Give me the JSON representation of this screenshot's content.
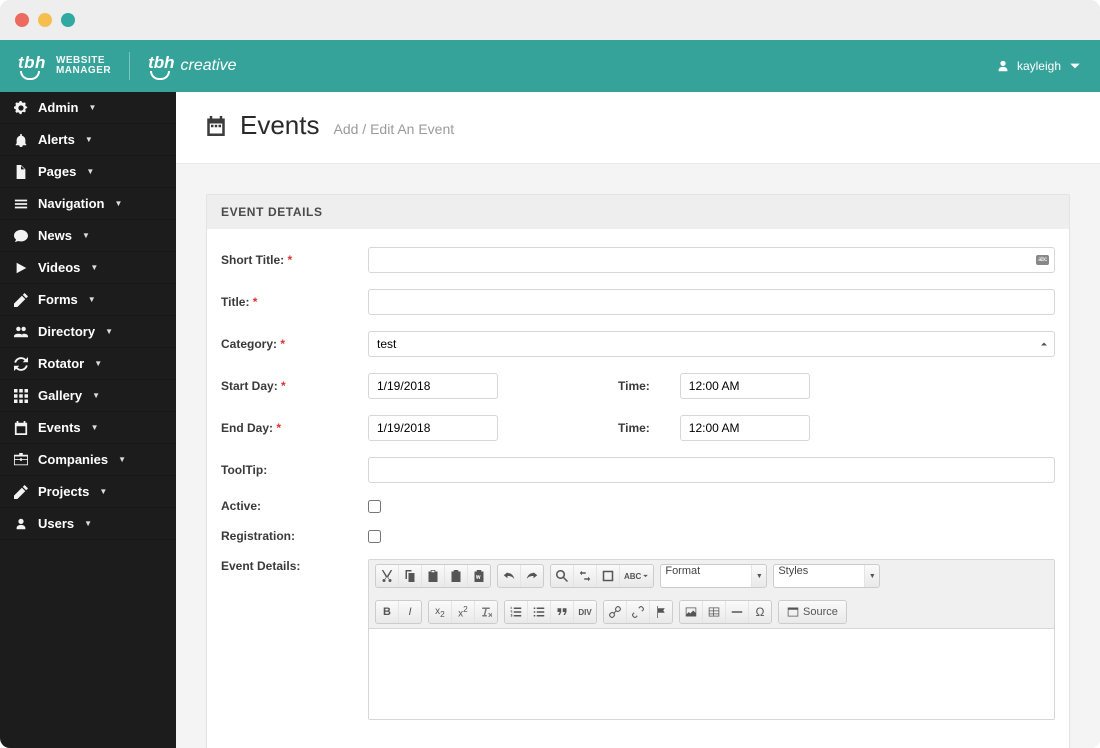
{
  "os": {
    "buttons": [
      "close",
      "minimize",
      "zoom"
    ]
  },
  "brand": {
    "mark": "tbh",
    "name_line1": "WEBSITE",
    "name_line2": "MANAGER",
    "secondary": "tbhcreative"
  },
  "user": {
    "name": "kayleigh"
  },
  "sidebar": {
    "items": [
      {
        "icon": "gear-icon",
        "label": "Admin"
      },
      {
        "icon": "bell-icon",
        "label": "Alerts"
      },
      {
        "icon": "file-icon",
        "label": "Pages"
      },
      {
        "icon": "bars-icon",
        "label": "Navigation"
      },
      {
        "icon": "chat-icon",
        "label": "News"
      },
      {
        "icon": "play-icon",
        "label": "Videos"
      },
      {
        "icon": "pencil-icon",
        "label": "Forms"
      },
      {
        "icon": "people-icon",
        "label": "Directory"
      },
      {
        "icon": "refresh-icon",
        "label": "Rotator"
      },
      {
        "icon": "grid-icon",
        "label": "Gallery"
      },
      {
        "icon": "calendar-icon",
        "label": "Events"
      },
      {
        "icon": "briefcase-icon",
        "label": "Companies"
      },
      {
        "icon": "pencil-icon",
        "label": "Projects"
      },
      {
        "icon": "user-icon",
        "label": "Users"
      }
    ]
  },
  "page": {
    "title": "Events",
    "subtitle": "Add / Edit An Event"
  },
  "panel": {
    "title": "EVENT DETAILS"
  },
  "form": {
    "short_title": {
      "label": "Short Title:",
      "value": ""
    },
    "title": {
      "label": "Title:",
      "value": ""
    },
    "category": {
      "label": "Category:",
      "value": "test"
    },
    "start_day": {
      "label": "Start Day:",
      "value": "1/19/2018",
      "time_label": "Time:",
      "time_value": "12:00 AM"
    },
    "end_day": {
      "label": "End Day:",
      "value": "1/19/2018",
      "time_label": "Time:",
      "time_value": "12:00 AM"
    },
    "tooltip": {
      "label": "ToolTip:",
      "value": ""
    },
    "active": {
      "label": "Active:",
      "checked": false
    },
    "registration": {
      "label": "Registration:",
      "checked": false
    },
    "details": {
      "label": "Event Details:"
    }
  },
  "rte": {
    "format_label": "Format",
    "styles_label": "Styles",
    "source_label": "Source"
  }
}
